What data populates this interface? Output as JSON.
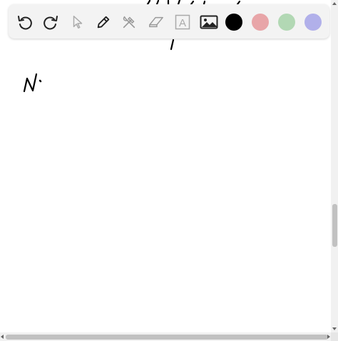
{
  "toolbar": {
    "tools": [
      {
        "name": "undo",
        "icon": "undo-icon"
      },
      {
        "name": "redo",
        "icon": "redo-icon"
      },
      {
        "name": "select",
        "icon": "cursor-icon"
      },
      {
        "name": "pen",
        "icon": "pencil-icon"
      },
      {
        "name": "tools",
        "icon": "tools-icon"
      },
      {
        "name": "eraser",
        "icon": "eraser-icon"
      },
      {
        "name": "text",
        "icon": "text-box-icon",
        "label": "A"
      },
      {
        "name": "image",
        "icon": "image-icon"
      }
    ],
    "colors": {
      "black": "#000000",
      "red": "#e8a5a8",
      "green": "#b2d8b4",
      "blue": "#b1b0ea"
    }
  },
  "canvas": {
    "handwriting": "N·"
  }
}
